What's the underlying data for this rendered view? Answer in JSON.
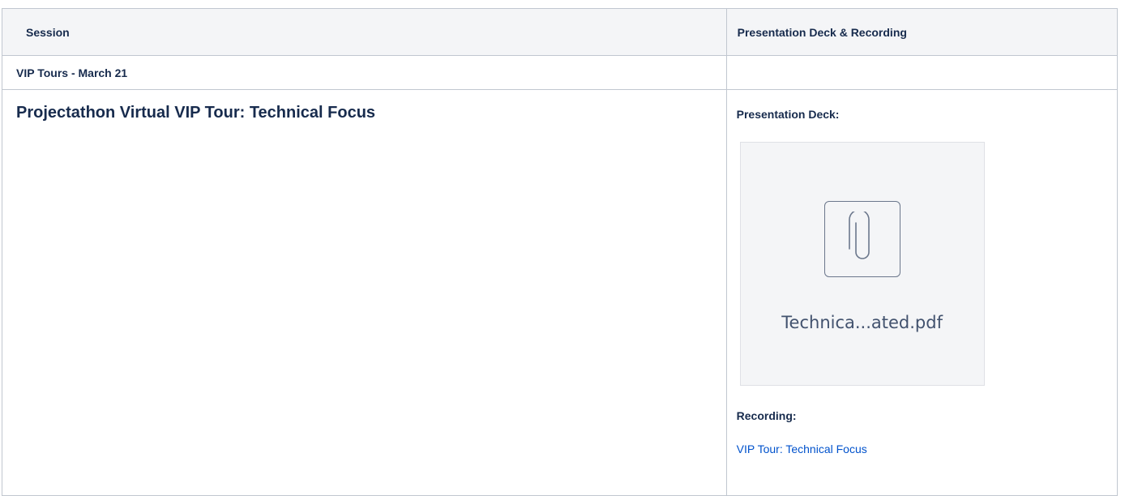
{
  "table": {
    "header": {
      "session": "Session",
      "deck_recording": "Presentation Deck & Recording"
    },
    "date_row": {
      "label": "VIP Tours - March 21",
      "right": ""
    },
    "session_row": {
      "title": "Projectathon Virtual VIP Tour: Technical Focus",
      "deck_label": "Presentation Deck:",
      "attachment": {
        "icon": "paperclip-icon",
        "filename": "Technica...ated.pdf"
      },
      "recording_label": "Recording:",
      "recording_link": "VIP Tour: Technical Focus"
    }
  },
  "colors": {
    "border": "#c1c7d0",
    "header_bg": "#f4f5f7",
    "text": "#172b4d",
    "link": "#0052cc",
    "attachment_bg": "#f4f5f7",
    "icon_stroke": "#6b778c"
  }
}
